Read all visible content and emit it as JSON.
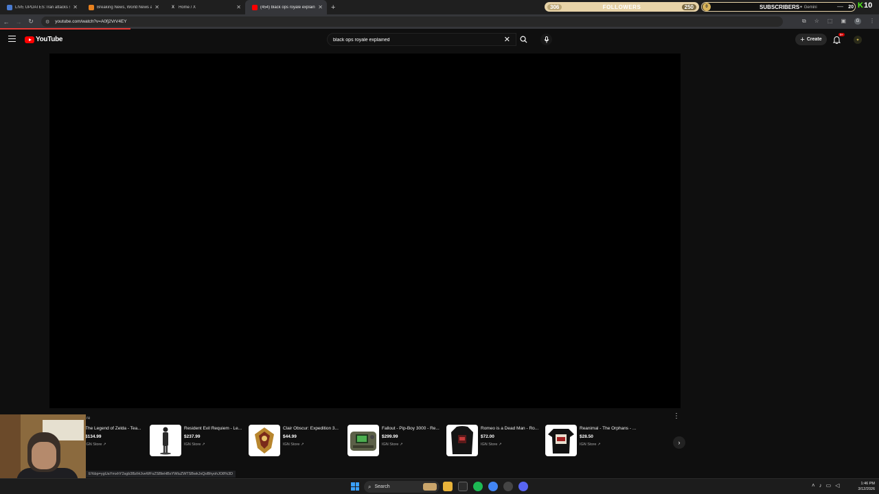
{
  "tabs": [
    {
      "title": "LIVE UPDATES: Iran attacks spa",
      "fav_color": "#4a7bd0"
    },
    {
      "title": "Breaking News, World News an",
      "fav_color": "#e8811e"
    },
    {
      "title": "Home / X",
      "fav_glyph": "X"
    },
    {
      "title": "(454) black ops royale explaine",
      "fav_color": "#ff0000"
    }
  ],
  "overlay": {
    "followers_current": "306",
    "followers_label": "FOLLOWERS",
    "followers_goal": "250",
    "subs_current": "0",
    "subs_label": "SUBSCRIBERS",
    "gemini_label": "✦ Gemini",
    "subs_goal": "20",
    "kick_count": "10"
  },
  "address": {
    "url": "youtube.com/watch?v=A0fj2VrV4EY"
  },
  "youtube": {
    "logo_text": "YouTube",
    "search_value": "black ops royale explained",
    "create_label": "Create",
    "notif_badge": "9+"
  },
  "shelf": {
    "title_fragment": "re",
    "products": [
      {
        "title": "The Legend of Zelda - Tea...",
        "price": "$134.99",
        "store": "IGN Store ↗"
      },
      {
        "title": "Resident Evil Requiem - Le...",
        "price": "$237.99",
        "store": "IGN Store ↗"
      },
      {
        "title": "Clair Obscur: Expedition 3...",
        "price": "$44.99",
        "store": "IGN Store ↗"
      },
      {
        "title": "Fallout - Pip-Boy 3000 - Re...",
        "price": "$299.99",
        "store": "IGN Store ↗"
      },
      {
        "title": "Romeo is a Dead Man - Ro...",
        "price": "$72.00",
        "store": "IGN Store ↗"
      },
      {
        "title": "Reanimal - The Orphans - ...",
        "price": "$28.50",
        "store": "IGN Store ↗"
      }
    ]
  },
  "status_url": "E%bp=ygUaYmxhY2sgb3BzIHJveWFsZSBleHBsYWluZWTSBwkJxQoBhyohJO8%3D",
  "taskbar": {
    "search_label": "Search",
    "time": "1:46 PM",
    "date": "3/12/2026"
  },
  "colors": {
    "accent": "#ff0000",
    "kick_green": "#53fc18"
  }
}
